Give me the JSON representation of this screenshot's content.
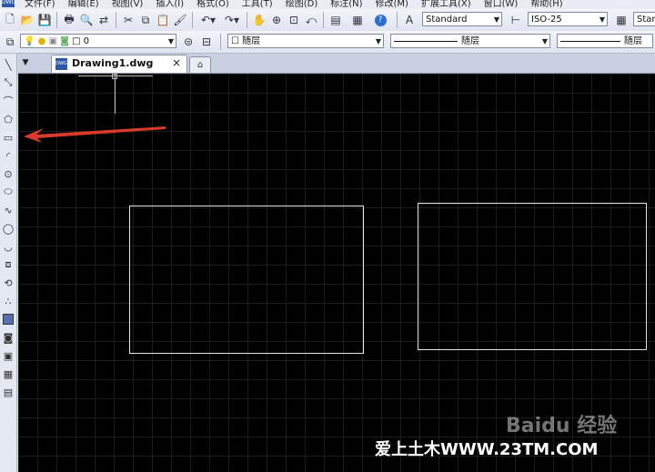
{
  "menu": {
    "logo": "DWG",
    "items": [
      "文件(F)",
      "编辑(E)",
      "视图(V)",
      "插入(I)",
      "格式(O)",
      "工具(T)",
      "绘图(D)",
      "标注(N)",
      "修改(M)",
      "扩展工具(X)",
      "窗口(W)",
      "帮助(H)"
    ]
  },
  "toolbar1": {
    "text_style": "Standard",
    "dim_style": "ISO-25",
    "table_style": "Stan"
  },
  "toolbar2": {
    "layer": "0",
    "color": "随层",
    "linetype": "随层",
    "lineweight": "随层"
  },
  "tabs": {
    "active_label": "Drawing1.dwg",
    "close_glyph": "×",
    "icon_text": "DWG"
  },
  "watermark": {
    "text": "爱上土木WWW.23TM.COM",
    "baidu": "Baidu 经验"
  },
  "colors": {
    "canvas": "#000000",
    "grid": "#1c1c1c",
    "arrow": "#d93a2b",
    "rectangle_stroke": "#e5e5e5"
  }
}
